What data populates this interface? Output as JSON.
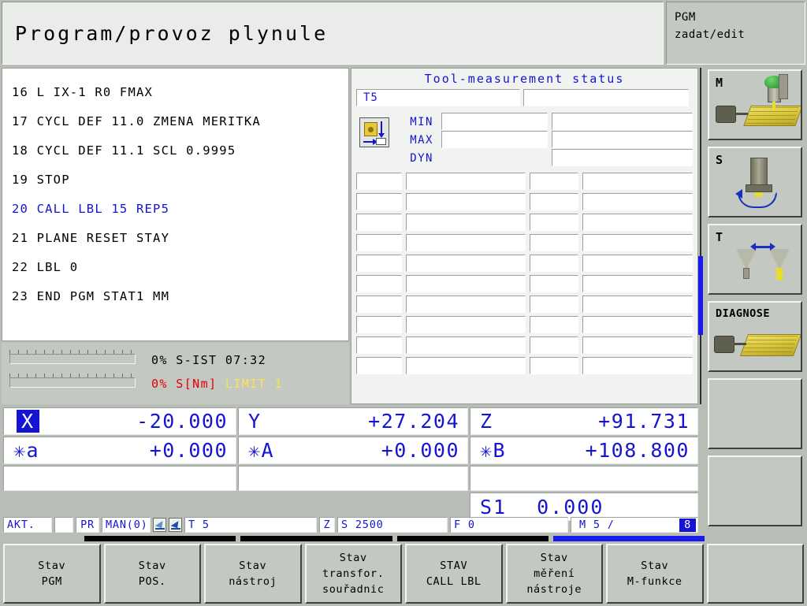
{
  "header": {
    "title": "Program/provoz plynule",
    "mode_line1": "PGM",
    "mode_line2": "zadat/edit"
  },
  "program": {
    "lines": [
      {
        "text": "16 L IX-1 R0 FMAX",
        "highlight": false
      },
      {
        "text": "17 CYCL DEF 11.0 ZMENA MERITKA",
        "highlight": false
      },
      {
        "text": "18 CYCL DEF 11.1 SCL 0.9995",
        "highlight": false
      },
      {
        "text": "19 STOP",
        "highlight": false
      },
      {
        "text": "20 CALL LBL 15 REP5",
        "highlight": true
      },
      {
        "text": "21 PLANE RESET STAY",
        "highlight": false
      },
      {
        "text": "22 LBL 0",
        "highlight": false
      },
      {
        "text": "23 END PGM STAT1 MM",
        "highlight": false
      }
    ]
  },
  "left_status": {
    "line1": "0% S-IST 07:32",
    "line2_percent": "0% S[Nm]",
    "line2_limit": "LIMIT 1",
    "bar1_value": 0,
    "bar2_value": 0
  },
  "tool_measurement": {
    "title": "Tool-measurement status",
    "tool": "T5",
    "tool_name": "",
    "labels": {
      "min": "MIN",
      "max": "MAX",
      "dyn": "DYN"
    },
    "min_a": "",
    "min_b": "",
    "max_a": "",
    "max_b": "",
    "dyn_b": "",
    "grid_rows": 10,
    "grid_values": [
      [
        "",
        "",
        "",
        ""
      ],
      [
        "",
        "",
        "",
        ""
      ],
      [
        "",
        "",
        "",
        ""
      ],
      [
        "",
        "",
        "",
        ""
      ],
      [
        "",
        "",
        "",
        ""
      ],
      [
        "",
        "",
        "",
        ""
      ],
      [
        "",
        "",
        "",
        ""
      ],
      [
        "",
        "",
        "",
        ""
      ],
      [
        "",
        "",
        "",
        ""
      ],
      [
        "",
        "",
        "",
        ""
      ]
    ]
  },
  "coordinates": {
    "row1": [
      {
        "axis": "X",
        "value": "-20.000",
        "selected": true
      },
      {
        "axis": "Y",
        "value": "+27.204",
        "selected": false
      },
      {
        "axis": "Z",
        "value": "+91.731",
        "selected": false
      }
    ],
    "row2": [
      {
        "axis": "✳a",
        "value": "+0.000",
        "selected": false
      },
      {
        "axis": "✳A",
        "value": "+0.000",
        "selected": false
      },
      {
        "axis": "✳B",
        "value": "+108.800",
        "selected": false
      }
    ],
    "spindle_label": "S1",
    "spindle_value": "0.000"
  },
  "status_line": {
    "akt": "AKT.",
    "blank": "",
    "pr": "PR",
    "man": "MAN(0)",
    "tool": "T 5",
    "z": "Z",
    "spindle_speed": "S 2500",
    "feed": "F 0",
    "m_text": "M 5 /",
    "m_value": "8"
  },
  "right_keys": [
    {
      "label": "M",
      "icon": "machine-m-icon"
    },
    {
      "label": "S",
      "icon": "spindle-s-icon"
    },
    {
      "label": "T",
      "icon": "tool-t-icon"
    },
    {
      "label": "DIAGNOSE",
      "icon": "diagnose-icon"
    },
    {
      "label": "",
      "icon": ""
    },
    {
      "label": "",
      "icon": ""
    }
  ],
  "bottom_keys": [
    {
      "line1": "Stav",
      "line2": "",
      "line3": "PGM"
    },
    {
      "line1": "Stav",
      "line2": "",
      "line3": "POS."
    },
    {
      "line1": "Stav",
      "line2": "",
      "line3": "nástroj"
    },
    {
      "line1": "Stav",
      "line2": "transfor.",
      "line3": "souřadnic"
    },
    {
      "line1": "STAV",
      "line2": "",
      "line3": "CALL LBL"
    },
    {
      "line1": "Stav",
      "line2": "měření",
      "line3": "nástroje"
    },
    {
      "line1": "Stav",
      "line2": "",
      "line3": "M-funkce"
    },
    {
      "line1": "",
      "line2": "",
      "line3": ""
    }
  ],
  "page_indicator": {
    "segments": [
      {
        "active": false
      },
      {
        "active": false
      },
      {
        "active": false
      },
      {
        "active": true
      }
    ]
  },
  "colors": {
    "accent_blue": "#1414d2",
    "panel_gray": "#c3c8c2",
    "warn_red": "#e50000",
    "limit_yellow": "#ffe24d"
  }
}
